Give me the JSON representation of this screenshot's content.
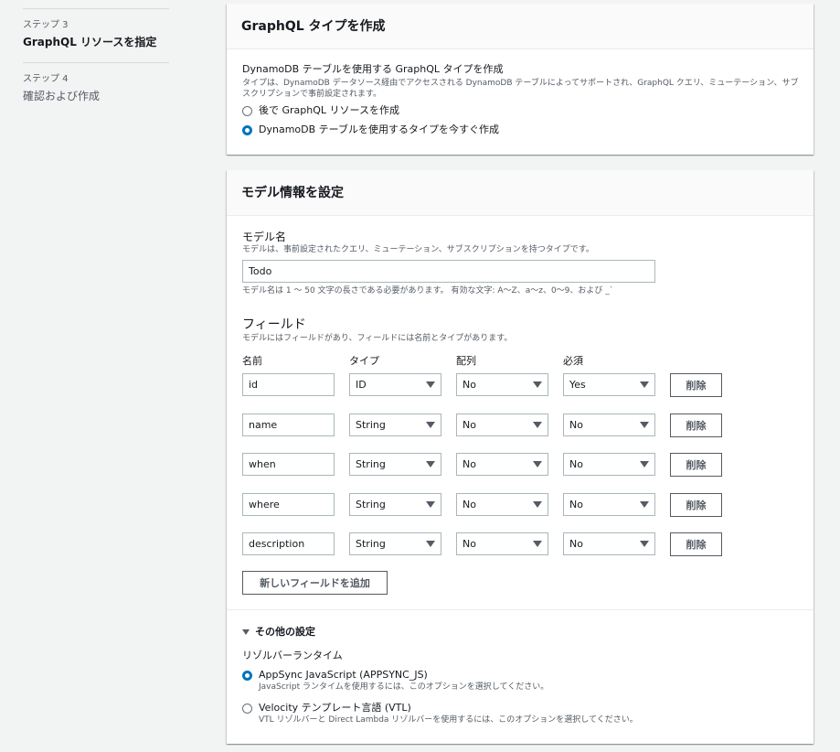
{
  "sidebar": {
    "steps": [
      {
        "num": "ステップ 3",
        "title": "GraphQL リソースを指定"
      },
      {
        "num": "ステップ 4",
        "title": "確認および作成"
      }
    ]
  },
  "graphql_panel": {
    "title": "GraphQL タイプを作成",
    "field_label": "DynamoDB テーブルを使用する GraphQL タイプを作成",
    "field_desc": "タイプは、DynamoDB データソース経由でアクセスされる DynamoDB テーブルによってサポートされ、GraphQL クエリ、ミューテーション、サブスクリプションで事前設定されます。",
    "option_later": "後で GraphQL リソースを作成",
    "option_now": "DynamoDB テーブルを使用するタイプを今すぐ作成"
  },
  "model_panel": {
    "title": "モデル情報を設定",
    "model_name_label": "モデル名",
    "model_name_desc": "モデルは、事前設定されたクエリ、ミューテーション、サブスクリプションを持つタイプです。",
    "model_name_value": "Todo",
    "model_name_hint": "モデル名は 1 ～ 50 文字の長さである必要があります。 有効な文字: A～Z、a～z、0～9、および _`",
    "fields_heading": "フィールド",
    "fields_desc": "モデルにはフィールドがあり、フィールドには名前とタイプがあります。",
    "columns": {
      "name": "名前",
      "type": "タイプ",
      "array": "配列",
      "required": "必須"
    },
    "rows": [
      {
        "name": "id",
        "type": "ID",
        "array": "No",
        "required": "Yes",
        "delete": "削除"
      },
      {
        "name": "name",
        "type": "String",
        "array": "No",
        "required": "No",
        "delete": "削除"
      },
      {
        "name": "when",
        "type": "String",
        "array": "No",
        "required": "No",
        "delete": "削除"
      },
      {
        "name": "where",
        "type": "String",
        "array": "No",
        "required": "No",
        "delete": "削除"
      },
      {
        "name": "description",
        "type": "String",
        "array": "No",
        "required": "No",
        "delete": "削除"
      }
    ],
    "add_field_button": "新しいフィールドを追加",
    "other_settings": "その他の設定",
    "resolver_runtime_label": "リゾルバーランタイム",
    "runtime_js_label": "AppSync JavaScript (APPSYNC_JS)",
    "runtime_js_desc": "JavaScript ランタイムを使用するには、このオプションを選択してください。",
    "runtime_vtl_label": "Velocity テンプレート言語 (VTL)",
    "runtime_vtl_desc": "VTL リゾルバーと Direct Lambda リゾルバーを使用するには、このオプションを選択してください。"
  },
  "colors": {
    "accent": "#0073bb",
    "background": "#f2f3f3",
    "border": "#aab7b8"
  }
}
